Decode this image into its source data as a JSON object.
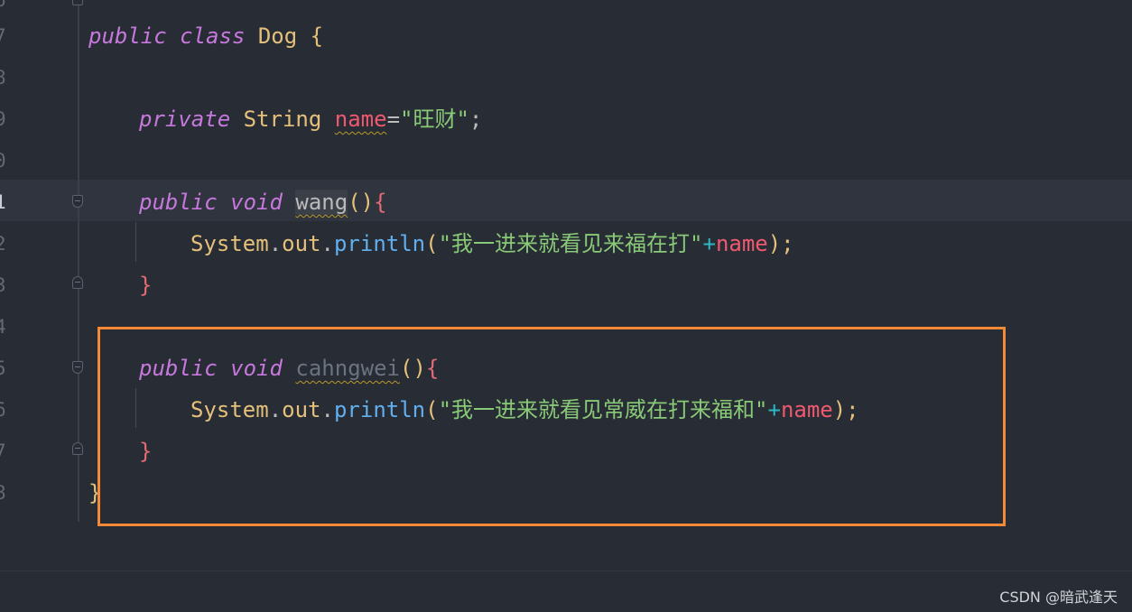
{
  "gutter": {
    "line_numbers": [
      "6",
      "7",
      "8",
      "9",
      "0",
      "1",
      "2",
      "3",
      "4",
      "5",
      "6",
      "7",
      "8"
    ],
    "active_line": "1"
  },
  "code": {
    "line_class": [
      "public",
      "class",
      "Dog",
      "{"
    ],
    "line_field": [
      "private",
      "String",
      "name",
      "=",
      "\"旺财\"",
      ";"
    ],
    "line_wang_sig": [
      "public",
      "void",
      "wang",
      "()",
      "{"
    ],
    "line_wang_body": [
      "System",
      ".",
      "out",
      ".",
      "println",
      "(",
      "\"我一进来就看见来福在打\"",
      "+",
      "name",
      ");"
    ],
    "line_wang_close": "}",
    "line_cahng_sig": [
      "public",
      "void",
      "cahngwei",
      "()",
      "{"
    ],
    "line_cahng_body": [
      "System",
      ".",
      "out",
      ".",
      "println",
      "(",
      "\"我一进来就看见常威在打来福和\"",
      "+",
      "name",
      ");"
    ],
    "line_cahng_close": "}",
    "line_class_close": "}"
  },
  "annotation": {
    "box_color": "#f48a38"
  },
  "colors": {
    "background": "#282c34",
    "keyword": "#c678dd",
    "type": "#e5c07b",
    "field": "#ef596f",
    "string": "#89ca78",
    "function": "#61afef"
  },
  "footer": {
    "watermark": "CSDN @暗武逢天"
  }
}
